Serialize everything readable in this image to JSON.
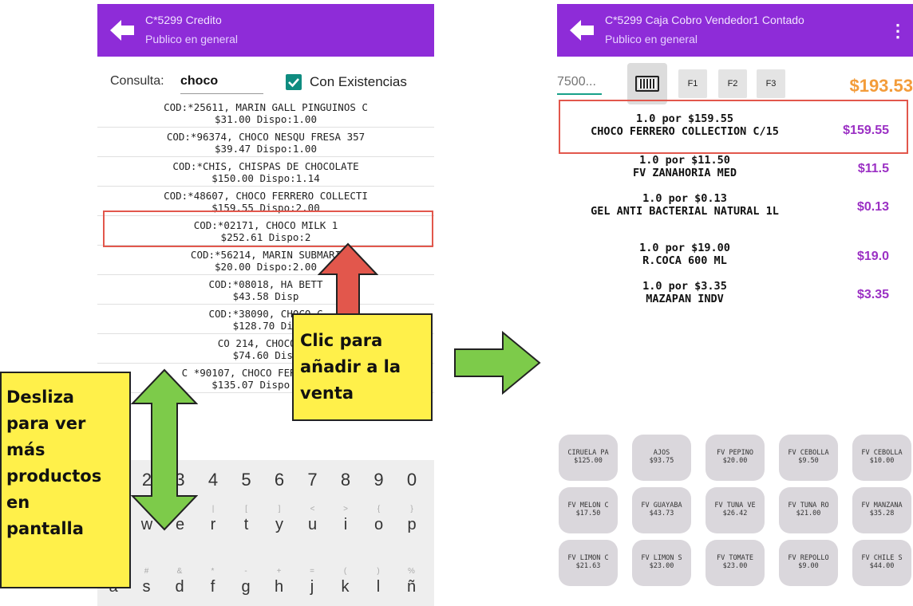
{
  "left_screen": {
    "header": {
      "title": "C*5299 Credito",
      "subtitle": "Publico en general"
    },
    "search": {
      "label": "Consulta:",
      "query": "choco",
      "checkbox_label": "Con Existencias",
      "checked": true
    },
    "items": [
      {
        "line1": "COD:*25611, MARIN GALL PINGUINOS C",
        "line2": "$31.00 Dispo:1.00"
      },
      {
        "line1": "COD:*96374, CHOCO NESQU FRESA  357",
        "line2": "$39.47 Dispo:1.00"
      },
      {
        "line1": "COD:*CHIS, CHISPAS DE CHOCOLATE",
        "line2": "$150.00 Dispo:1.14"
      },
      {
        "line1": "COD:*48607, CHOCO FERRERO COLLECTI",
        "line2": "$159.55 Dispo:2.00"
      },
      {
        "line1": "COD:*02171, CHOCO MILK 1",
        "line2": "$252.61 Dispo:2"
      },
      {
        "line1": "COD:*56214, MARIN SUBMARI",
        "line2": "$20.00 Dispo:2.00"
      },
      {
        "line1": "COD:*08018, HA BETT",
        "line2": "$43.58 Disp"
      },
      {
        "line1": "COD:*38090, CHOCO C",
        "line2": "$128.70 Dis"
      },
      {
        "line1": "CO   214, CHOCOLAT",
        "line2": "$74.60 Disp"
      },
      {
        "line1": "C   *90107, CHOCO FERRERO C/16",
        "line2": "$135.07 Dispo:3.00"
      }
    ],
    "keyboard": {
      "numbers": [
        "2",
        "3",
        "4",
        "5",
        "6",
        "7",
        "8",
        "9",
        "0"
      ],
      "row2": [
        {
          "key": "w",
          "alt": "~"
        },
        {
          "key": "e",
          "alt": "\\"
        },
        {
          "key": "r",
          "alt": "|"
        },
        {
          "key": "t",
          "alt": "["
        },
        {
          "key": "y",
          "alt": "]"
        },
        {
          "key": "u",
          "alt": "<"
        },
        {
          "key": "i",
          "alt": ">"
        },
        {
          "key": "o",
          "alt": "{"
        },
        {
          "key": "p",
          "alt": "}"
        }
      ],
      "row3": [
        {
          "key": "a",
          "alt": "@"
        },
        {
          "key": "s",
          "alt": "#"
        },
        {
          "key": "d",
          "alt": "&"
        },
        {
          "key": "f",
          "alt": "*"
        },
        {
          "key": "g",
          "alt": "-"
        },
        {
          "key": "h",
          "alt": "+"
        },
        {
          "key": "j",
          "alt": "="
        },
        {
          "key": "k",
          "alt": "("
        },
        {
          "key": "l",
          "alt": ")"
        },
        {
          "key": "ñ",
          "alt": "%"
        }
      ]
    }
  },
  "right_screen": {
    "header": {
      "title": "C*5299 Caja Cobro Vendedor1 Contado",
      "subtitle": "Publico en general"
    },
    "toolbar": {
      "code_placeholder": "7500...",
      "f_keys": [
        "F1",
        "F2",
        "F3"
      ],
      "total": "$193.53"
    },
    "sale_items": [
      {
        "qty": "1.0 por $159.55",
        "name": "CHOCO FERRERO COLLECTION C/15",
        "price": "$159.55"
      },
      {
        "qty": "1.0 por $11.50",
        "name": "FV ZANAHORIA MED",
        "price": "$11.5"
      },
      {
        "qty": "1.0 por $0.13",
        "name": "GEL ANTI BACTERIAL NATURAL 1L",
        "price": "$0.13"
      },
      {
        "qty": "1.0 por $19.00",
        "name": "R.COCA 600 ML",
        "price": "$19.0"
      },
      {
        "qty": "1.0 por $3.35",
        "name": "MAZAPAN INDV",
        "price": "$3.35"
      }
    ],
    "product_buttons": [
      {
        "name": "CIRUELA PA",
        "price": "$125.00"
      },
      {
        "name": "AJOS",
        "price": "$93.75"
      },
      {
        "name": "FV PEPINO",
        "price": "$20.00"
      },
      {
        "name": "FV CEBOLLA",
        "price": "$9.50"
      },
      {
        "name": "FV CEBOLLA",
        "price": "$10.00"
      },
      {
        "name": "FV MELON C",
        "price": "$17.50"
      },
      {
        "name": "FV GUAYABA",
        "price": "$43.73"
      },
      {
        "name": "FV TUNA VE",
        "price": "$26.42"
      },
      {
        "name": "FV TUNA RO",
        "price": "$21.00"
      },
      {
        "name": "FV MANZANA",
        "price": "$35.28"
      },
      {
        "name": "FV LIMON C",
        "price": "$21.63"
      },
      {
        "name": "FV LIMON S",
        "price": "$23.00"
      },
      {
        "name": "FV TOMATE",
        "price": "$23.00"
      },
      {
        "name": "FV REPOLLO",
        "price": "$9.00"
      },
      {
        "name": "FV CHILE S",
        "price": "$44.00"
      }
    ]
  },
  "annotations": {
    "click_callout": [
      "Clic para",
      "añadir a la",
      "venta"
    ],
    "swipe_callout": [
      "Desliza",
      "para ver",
      "más",
      "productos",
      "en",
      "pantalla"
    ]
  },
  "colors": {
    "header": "#8e2cd8",
    "accent_teal": "#0f8c80",
    "price_purple": "#9b30c4",
    "total_orange": "#f39c3a",
    "highlight_red": "#e2574c",
    "arrow_green": "#7dcb4a",
    "callout_yellow": "#fff04a"
  }
}
